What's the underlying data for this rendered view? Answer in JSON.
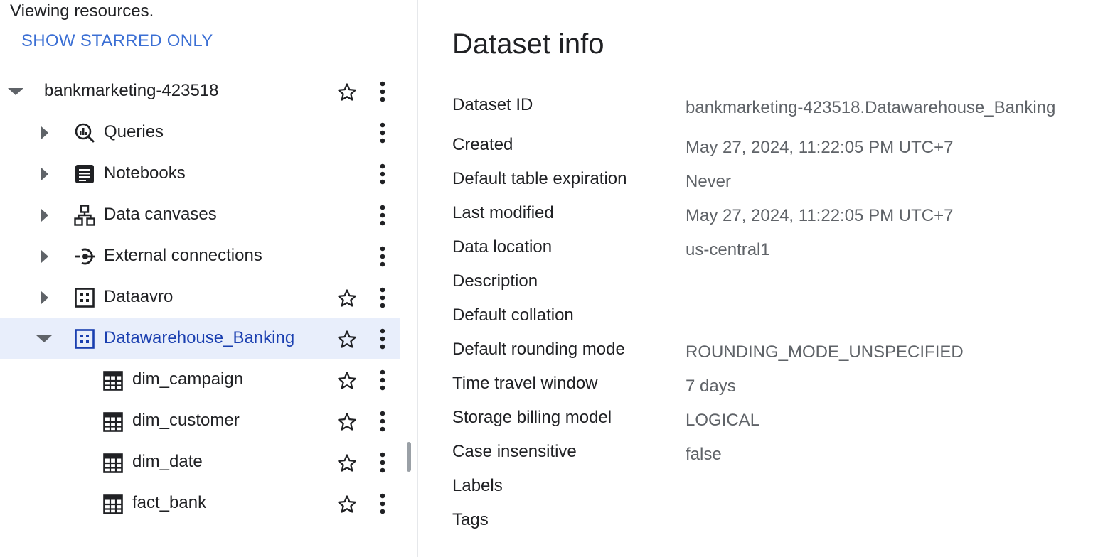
{
  "explorer": {
    "viewing_text": "Viewing resources.",
    "show_starred_label": "SHOW STARRED ONLY",
    "project": {
      "name": "bankmarketing-423518"
    },
    "items": [
      {
        "label": "Queries",
        "icon": "queries-icon"
      },
      {
        "label": "Notebooks",
        "icon": "notebook-icon"
      },
      {
        "label": "Data canvases",
        "icon": "data-canvas-icon"
      },
      {
        "label": "External connections",
        "icon": "external-connection-icon"
      },
      {
        "label": "Dataavro",
        "icon": "dataset-icon"
      },
      {
        "label": "Datawarehouse_Banking",
        "icon": "dataset-icon"
      }
    ],
    "tables": [
      {
        "label": "dim_campaign",
        "icon": "table-icon"
      },
      {
        "label": "dim_customer",
        "icon": "table-icon"
      },
      {
        "label": "dim_date",
        "icon": "table-icon"
      },
      {
        "label": "fact_bank",
        "icon": "table-icon"
      }
    ]
  },
  "dataset_info": {
    "title": "Dataset info",
    "rows": [
      {
        "key": "Dataset ID",
        "value": "bankmarketing-423518.Datawarehouse_Banking"
      },
      {
        "key": "Created",
        "value": "May 27, 2024, 11:22:05 PM UTC+7"
      },
      {
        "key": "Default table expiration",
        "value": "Never"
      },
      {
        "key": "Last modified",
        "value": "May 27, 2024, 11:22:05 PM UTC+7"
      },
      {
        "key": "Data location",
        "value": "us-central1"
      },
      {
        "key": "Description",
        "value": ""
      },
      {
        "key": "Default collation",
        "value": ""
      },
      {
        "key": "Default rounding mode",
        "value": "ROUNDING_MODE_UNSPECIFIED"
      },
      {
        "key": "Time travel window",
        "value": "7 days"
      },
      {
        "key": "Storage billing model",
        "value": "LOGICAL"
      },
      {
        "key": "Case insensitive",
        "value": "false"
      },
      {
        "key": "Labels",
        "value": ""
      },
      {
        "key": "Tags",
        "value": ""
      }
    ]
  },
  "colors": {
    "accent": "#3b6fd4",
    "selected_bg": "#e8eefb",
    "selected_text": "#1a3fb0"
  }
}
